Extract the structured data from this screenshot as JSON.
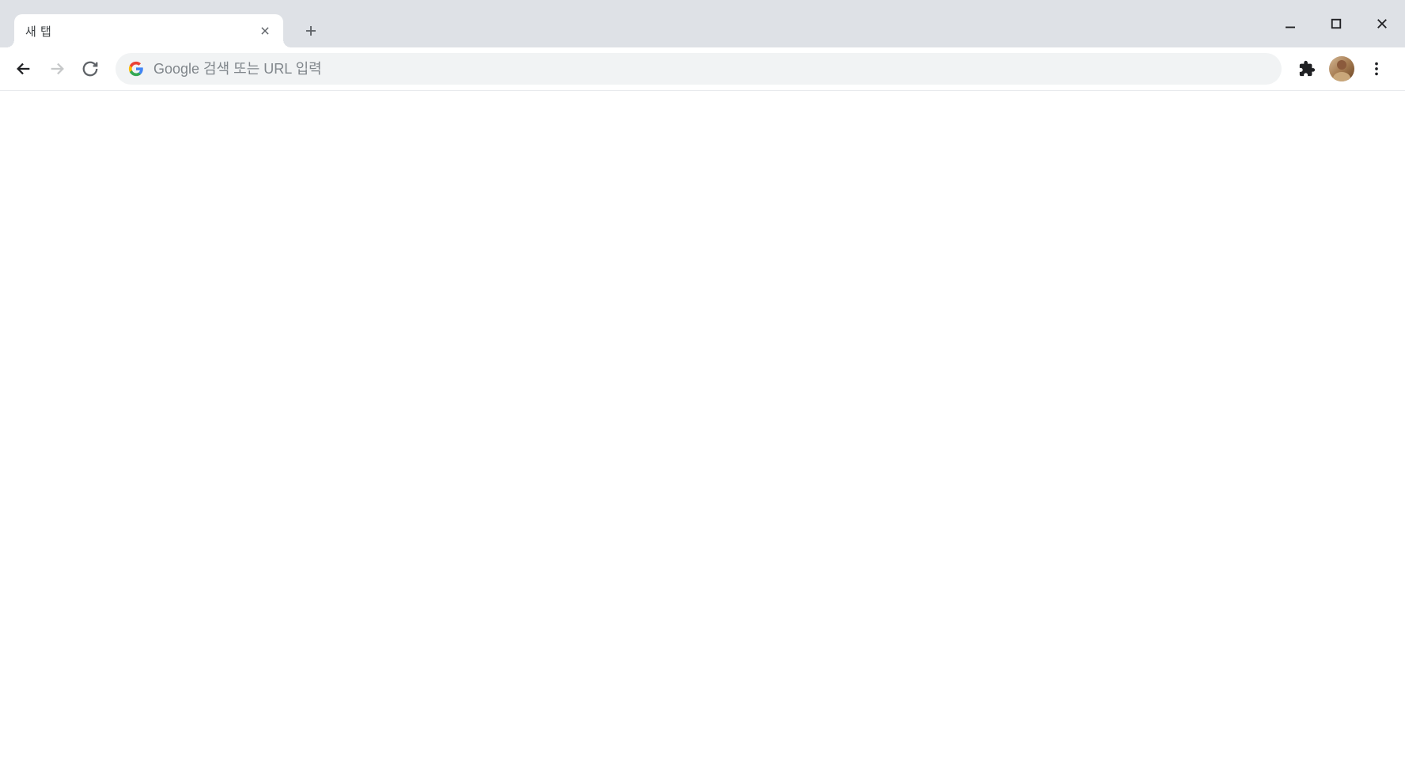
{
  "tab": {
    "title": "새 탭"
  },
  "omnibox": {
    "placeholder": "Google 검색 또는 URL 입력"
  }
}
